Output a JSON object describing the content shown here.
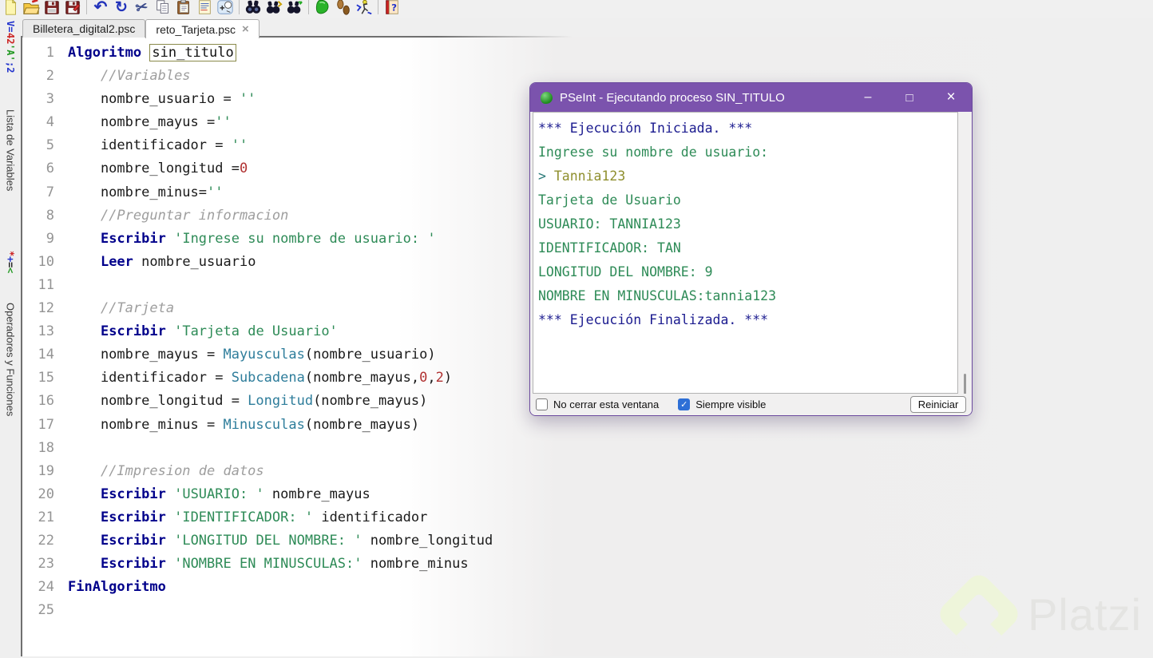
{
  "colors": {
    "titlebar_purple": "#7b53ad",
    "keyword_blue": "#00008b",
    "string_green": "#2e8b57",
    "number_red": "#b03131",
    "function_teal": "#2e7d9b",
    "comment_gray": "#9e9e9e",
    "console_system_blue": "#1b1b8f",
    "console_output_green": "#2e8b57",
    "console_input_olive": "#8f8f2e",
    "checkbox_blue": "#2e6fd6",
    "watermark_green": "#eef5da"
  },
  "toolbar": {
    "items": [
      "new-file",
      "open-file",
      "save",
      "save-as",
      "|",
      "undo",
      "redo",
      "cut",
      "copy",
      "paste",
      "format-source",
      "insert-snippet",
      "|",
      "find",
      "find-next",
      "replace",
      "|",
      "run",
      "step-run",
      "run-to-line",
      "|",
      "help"
    ]
  },
  "tabs": {
    "items": [
      {
        "label": "Billetera_digital2.psc",
        "active": false,
        "closable": false
      },
      {
        "label": "reto_Tarjeta.psc",
        "active": true,
        "closable": true,
        "close_glyph": "×"
      }
    ]
  },
  "sidebar": {
    "panels": [
      {
        "icon_segs": [
          {
            "t": "V=",
            "c": "#2233cc"
          },
          {
            "t": "42",
            "c": "#cc2222"
          },
          {
            "t": "'A'",
            "c": "#229922"
          },
          {
            "t": ";2",
            "c": "#2233cc"
          }
        ],
        "label": "Lista de Variables"
      },
      {
        "icon_segs": [
          {
            "t": "*",
            "c": "#cc2222"
          },
          {
            "t": "+",
            "c": "#2233cc"
          },
          {
            "t": "=",
            "c": "#222222"
          },
          {
            "t": "<",
            "c": "#229922"
          }
        ],
        "label": "Operadores y Funciones"
      }
    ]
  },
  "editor": {
    "lines": [
      {
        "n": "1",
        "segs": [
          {
            "c": "kw",
            "t": "Algoritmo"
          },
          {
            "c": "pl",
            "t": " "
          },
          {
            "c": "bx",
            "t": "sin_titulo"
          }
        ]
      },
      {
        "n": "2",
        "segs": [
          {
            "c": "pl",
            "t": "    "
          },
          {
            "c": "cm",
            "t": "//Variables"
          }
        ]
      },
      {
        "n": "3",
        "segs": [
          {
            "c": "pl",
            "t": "    nombre_usuario = "
          },
          {
            "c": "st",
            "t": "''"
          }
        ]
      },
      {
        "n": "4",
        "segs": [
          {
            "c": "pl",
            "t": "    nombre_mayus ="
          },
          {
            "c": "st",
            "t": "''"
          }
        ]
      },
      {
        "n": "5",
        "segs": [
          {
            "c": "pl",
            "t": "    identificador = "
          },
          {
            "c": "st",
            "t": "''"
          }
        ]
      },
      {
        "n": "6",
        "segs": [
          {
            "c": "pl",
            "t": "    nombre_longitud ="
          },
          {
            "c": "nu",
            "t": "0"
          }
        ]
      },
      {
        "n": "7",
        "segs": [
          {
            "c": "pl",
            "t": "    nombre_minus="
          },
          {
            "c": "st",
            "t": "''"
          }
        ]
      },
      {
        "n": "8",
        "segs": [
          {
            "c": "pl",
            "t": "    "
          },
          {
            "c": "cm",
            "t": "//Preguntar informacion"
          }
        ]
      },
      {
        "n": "9",
        "segs": [
          {
            "c": "pl",
            "t": "    "
          },
          {
            "c": "kw",
            "t": "Escribir"
          },
          {
            "c": "pl",
            "t": " "
          },
          {
            "c": "st",
            "t": "'Ingrese su nombre de usuario: '"
          }
        ]
      },
      {
        "n": "10",
        "segs": [
          {
            "c": "pl",
            "t": "    "
          },
          {
            "c": "kw",
            "t": "Leer"
          },
          {
            "c": "pl",
            "t": " nombre_usuario"
          }
        ]
      },
      {
        "n": "11",
        "segs": []
      },
      {
        "n": "12",
        "segs": [
          {
            "c": "pl",
            "t": "    "
          },
          {
            "c": "cm",
            "t": "//Tarjeta"
          }
        ]
      },
      {
        "n": "13",
        "segs": [
          {
            "c": "pl",
            "t": "    "
          },
          {
            "c": "kw",
            "t": "Escribir"
          },
          {
            "c": "pl",
            "t": " "
          },
          {
            "c": "st",
            "t": "'Tarjeta de Usuario'"
          }
        ]
      },
      {
        "n": "14",
        "segs": [
          {
            "c": "pl",
            "t": "    nombre_mayus = "
          },
          {
            "c": "fn",
            "t": "Mayusculas"
          },
          {
            "c": "pl",
            "t": "(nombre_usuario)"
          }
        ]
      },
      {
        "n": "15",
        "segs": [
          {
            "c": "pl",
            "t": "    identificador = "
          },
          {
            "c": "fn",
            "t": "Subcadena"
          },
          {
            "c": "pl",
            "t": "(nombre_mayus,"
          },
          {
            "c": "nu",
            "t": "0"
          },
          {
            "c": "pl",
            "t": ","
          },
          {
            "c": "nu",
            "t": "2"
          },
          {
            "c": "pl",
            "t": ")"
          }
        ]
      },
      {
        "n": "16",
        "segs": [
          {
            "c": "pl",
            "t": "    nombre_longitud = "
          },
          {
            "c": "fn",
            "t": "Longitud"
          },
          {
            "c": "pl",
            "t": "(nombre_mayus)"
          }
        ]
      },
      {
        "n": "17",
        "segs": [
          {
            "c": "pl",
            "t": "    nombre_minus = "
          },
          {
            "c": "fn",
            "t": "Minusculas"
          },
          {
            "c": "pl",
            "t": "(nombre_mayus)"
          }
        ]
      },
      {
        "n": "18",
        "segs": []
      },
      {
        "n": "19",
        "segs": [
          {
            "c": "pl",
            "t": "    "
          },
          {
            "c": "cm",
            "t": "//Impresion de datos"
          }
        ]
      },
      {
        "n": "20",
        "segs": [
          {
            "c": "pl",
            "t": "    "
          },
          {
            "c": "kw",
            "t": "Escribir"
          },
          {
            "c": "pl",
            "t": " "
          },
          {
            "c": "st",
            "t": "'USUARIO: '"
          },
          {
            "c": "pl",
            "t": " nombre_mayus"
          }
        ]
      },
      {
        "n": "21",
        "segs": [
          {
            "c": "pl",
            "t": "    "
          },
          {
            "c": "kw",
            "t": "Escribir"
          },
          {
            "c": "pl",
            "t": " "
          },
          {
            "c": "st",
            "t": "'IDENTIFICADOR: '"
          },
          {
            "c": "pl",
            "t": " identificador"
          }
        ]
      },
      {
        "n": "22",
        "segs": [
          {
            "c": "pl",
            "t": "    "
          },
          {
            "c": "kw",
            "t": "Escribir"
          },
          {
            "c": "pl",
            "t": " "
          },
          {
            "c": "st",
            "t": "'LONGITUD DEL NOMBRE: '"
          },
          {
            "c": "pl",
            "t": " nombre_longitud"
          }
        ]
      },
      {
        "n": "23",
        "segs": [
          {
            "c": "pl",
            "t": "    "
          },
          {
            "c": "kw",
            "t": "Escribir"
          },
          {
            "c": "pl",
            "t": " "
          },
          {
            "c": "st",
            "t": "'NOMBRE EN MINUSCULAS:'"
          },
          {
            "c": "pl",
            "t": " nombre_minus"
          }
        ]
      },
      {
        "n": "24",
        "segs": [
          {
            "c": "kw",
            "t": "FinAlgoritmo"
          }
        ]
      },
      {
        "n": "25",
        "segs": []
      }
    ]
  },
  "exec_window": {
    "title": "PSeInt - Ejecutando proceso SIN_TITULO",
    "window_controls": {
      "minimize": "–",
      "maximize": "□",
      "close": "×"
    },
    "console_lines": [
      {
        "segs": [
          {
            "c": "sys",
            "t": "*** Ejecución Iniciada. ***"
          }
        ]
      },
      {
        "segs": [
          {
            "c": "out",
            "t": "Ingrese su nombre de usuario: "
          }
        ]
      },
      {
        "segs": [
          {
            "c": "prm",
            "t": "> "
          },
          {
            "c": "inp",
            "t": "Tannia123"
          }
        ]
      },
      {
        "segs": [
          {
            "c": "out",
            "t": "Tarjeta de Usuario"
          }
        ]
      },
      {
        "segs": [
          {
            "c": "out",
            "t": "USUARIO: TANNIA123"
          }
        ]
      },
      {
        "segs": [
          {
            "c": "out",
            "t": "IDENTIFICADOR: TAN"
          }
        ]
      },
      {
        "segs": [
          {
            "c": "out",
            "t": "LONGITUD DEL NOMBRE: 9"
          }
        ]
      },
      {
        "segs": [
          {
            "c": "out",
            "t": "NOMBRE EN MINUSCULAS:tannia123"
          }
        ]
      },
      {
        "segs": [
          {
            "c": "sys",
            "t": "*** Ejecución Finalizada. ***"
          }
        ]
      }
    ],
    "footer": {
      "checkbox_no_close_label": "No cerrar esta ventana",
      "checkbox_no_close_checked": false,
      "checkbox_always_visible_label": "Siempre visible",
      "checkbox_always_visible_checked": true,
      "check_glyph": "✓",
      "restart_label": "Reiniciar"
    }
  },
  "watermark": {
    "text": "Platzi"
  }
}
